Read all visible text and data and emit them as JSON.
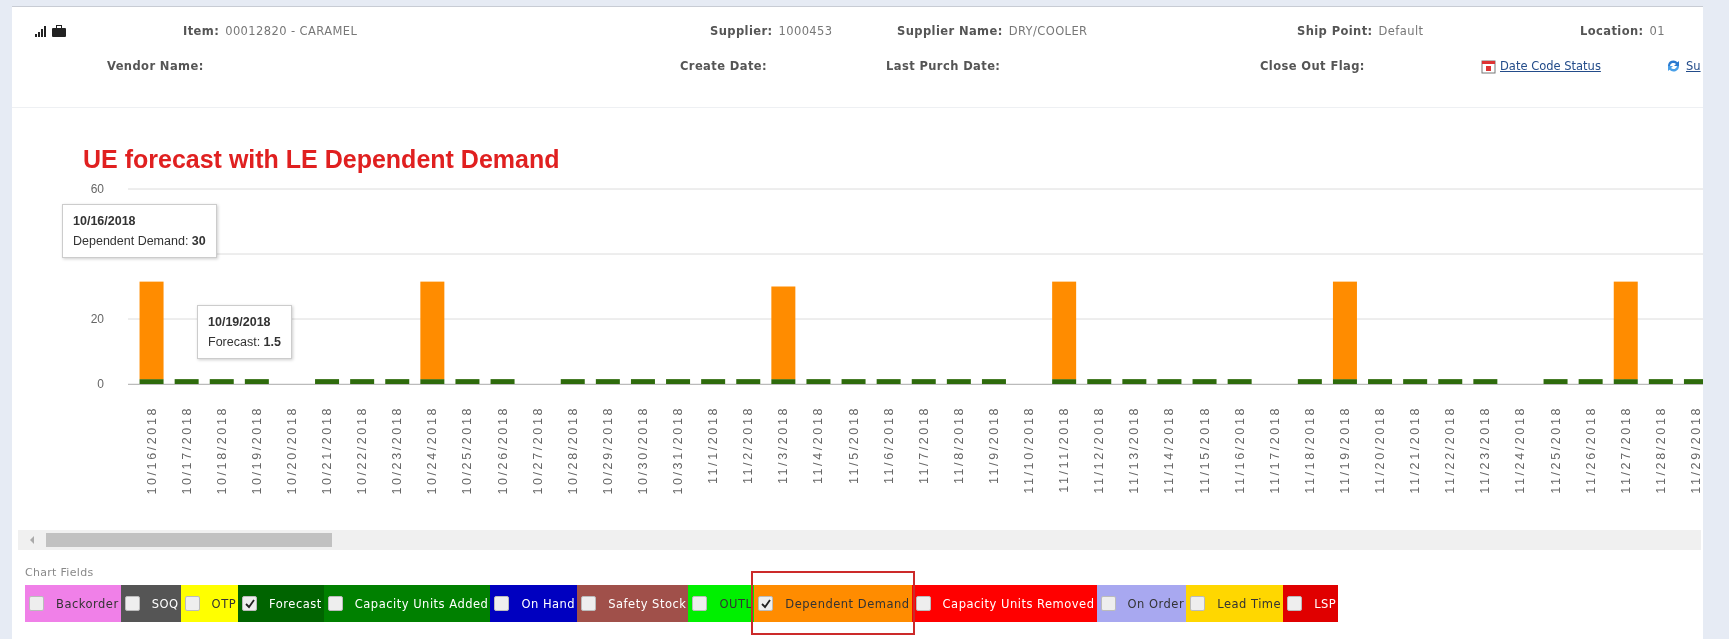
{
  "header": {
    "row_1": [
      {
        "label": "Item:",
        "value": "00012820 - CARAMEL"
      },
      {
        "label": "Supplier:",
        "value": "1000453"
      },
      {
        "label": "Supplier Name:",
        "value": "DRY/COOLER"
      },
      {
        "label": "Ship Point:",
        "value": "Default"
      },
      {
        "label": "Location:",
        "value": "01"
      }
    ],
    "row_2": [
      {
        "label": "Vendor Name:"
      },
      {
        "label": "Create Date:"
      },
      {
        "label": "Last Purch Date:"
      },
      {
        "label": "Close Out Flag:"
      }
    ],
    "links": [
      {
        "label": "Date Code Status"
      },
      {
        "label": "Su"
      }
    ]
  },
  "chart": {
    "title": "UE forecast with LE Dependent Demand",
    "chart_data": {
      "type": "bar",
      "stacked": true,
      "categories": [
        "10/16/2018",
        "10/17/2018",
        "10/18/2018",
        "10/19/2018",
        "10/20/2018",
        "10/21/2018",
        "10/22/2018",
        "10/23/2018",
        "10/24/2018",
        "10/25/2018",
        "10/26/2018",
        "10/27/2018",
        "10/28/2018",
        "10/29/2018",
        "10/30/2018",
        "10/31/2018",
        "11/1/2018",
        "11/2/2018",
        "11/3/2018",
        "11/4/2018",
        "11/5/2018",
        "11/6/2018",
        "11/7/2018",
        "11/8/2018",
        "11/9/2018",
        "11/10/2018",
        "11/11/2018",
        "11/12/2018",
        "11/13/2018",
        "11/14/2018",
        "11/15/2018",
        "11/16/2018",
        "11/17/2018",
        "11/18/2018",
        "11/19/2018",
        "11/20/2018",
        "11/21/2018",
        "11/22/2018",
        "11/23/2018",
        "11/24/2018",
        "11/25/2018",
        "11/26/2018",
        "11/27/2018",
        "11/28/2018",
        "11/29/2018"
      ],
      "series": [
        {
          "color": "#2e6b0c",
          "values": [
            1.5,
            1.5,
            1.5,
            1.5,
            null,
            1.5,
            1.5,
            1.5,
            1.5,
            1.5,
            1.5,
            null,
            1.5,
            1.5,
            1.5,
            1.5,
            1.5,
            1.5,
            1.5,
            1.5,
            1.5,
            1.5,
            1.5,
            1.5,
            1.5,
            null,
            1.5,
            1.5,
            1.5,
            1.5,
            1.5,
            1.5,
            null,
            1.5,
            1.5,
            1.5,
            1.5,
            1.5,
            1.5,
            null,
            1.5,
            1.5,
            1.5,
            1.5,
            1.5
          ]
        },
        {
          "color": "#ff8c00",
          "values": [
            30,
            null,
            null,
            null,
            null,
            null,
            null,
            null,
            30,
            null,
            null,
            null,
            null,
            null,
            null,
            null,
            null,
            null,
            28.5,
            null,
            null,
            null,
            null,
            null,
            null,
            null,
            30,
            null,
            null,
            null,
            null,
            null,
            null,
            null,
            30,
            null,
            null,
            null,
            null,
            null,
            null,
            null,
            30,
            null,
            null
          ]
        }
      ],
      "ylim": [
        0,
        60
      ],
      "yticks": [
        0,
        20,
        60
      ]
    },
    "tooltips": [
      {
        "date": "10/16/2018",
        "label": "Dependent Demand:",
        "value": "30"
      },
      {
        "date": "10/19/2018",
        "label": "Forecast:",
        "value": "1.5"
      }
    ]
  },
  "legend": {
    "title": "Chart Fields",
    "items": [
      {
        "label": "Backorder",
        "color": "#f080e8",
        "checked": false,
        "highlighted": false
      },
      {
        "label": "SOQ",
        "color": "#555555",
        "checked": false,
        "highlighted": false
      },
      {
        "label": "OTP",
        "color": "#ffff00",
        "checked": false,
        "highlighted": false
      },
      {
        "label": "Forecast",
        "color": "#006400",
        "checked": true,
        "highlighted": false
      },
      {
        "label": "Capacity Units Added",
        "color": "#008000",
        "checked": false,
        "highlighted": false
      },
      {
        "label": "On Hand",
        "color": "#0000c0",
        "checked": false,
        "highlighted": false
      },
      {
        "label": "Safety Stock",
        "color": "#a0504a",
        "checked": false,
        "highlighted": false
      },
      {
        "label": "OUTL",
        "color": "#00f000",
        "checked": false,
        "highlighted": false
      },
      {
        "label": "Dependent Demand",
        "color": "#ff8c00",
        "checked": true,
        "highlighted": true
      },
      {
        "label": "Capacity Units Removed",
        "color": "#ff0000",
        "checked": false,
        "highlighted": false
      },
      {
        "label": "On Order",
        "color": "#a8a8f0",
        "checked": false,
        "highlighted": false
      },
      {
        "label": "Lead Time",
        "color": "#ffd700",
        "checked": false,
        "highlighted": false
      },
      {
        "label": "LSP",
        "color": "#e00000",
        "checked": false,
        "highlighted": false
      }
    ]
  }
}
